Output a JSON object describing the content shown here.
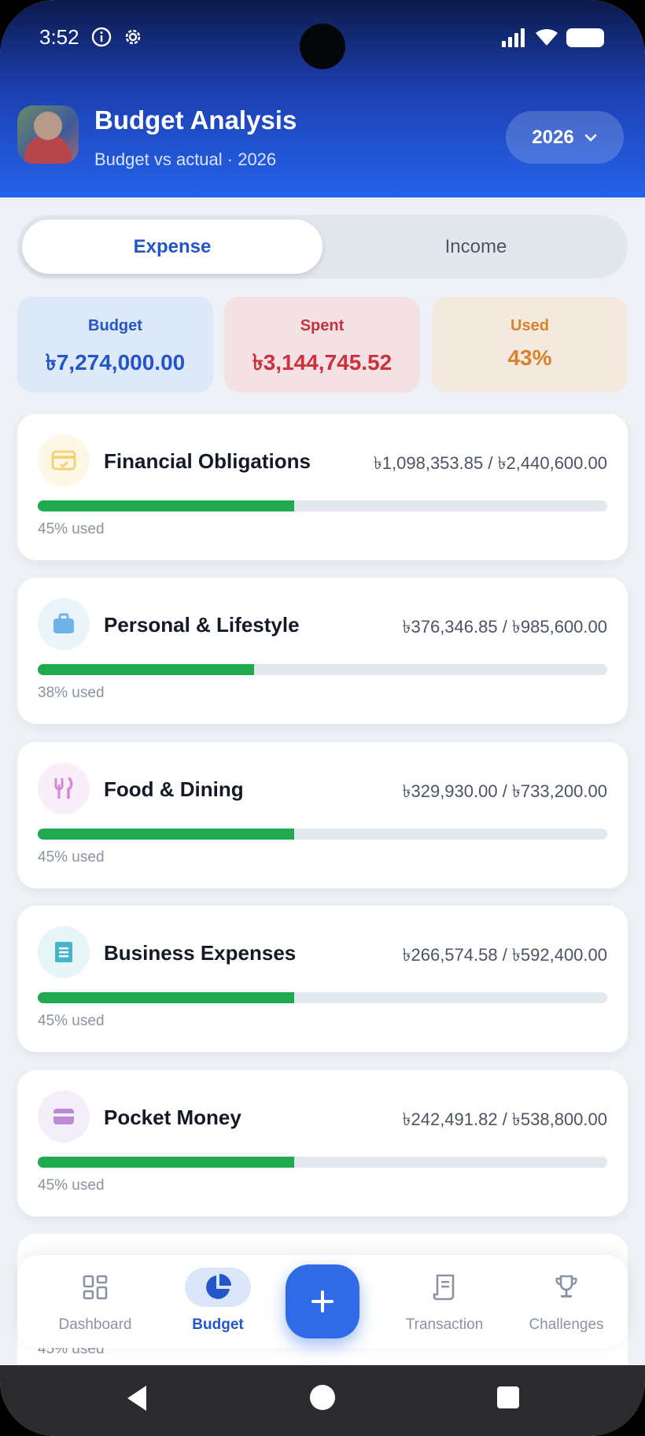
{
  "status_bar": {
    "time": "3:52"
  },
  "header": {
    "title": "Budget Analysis",
    "subtitle": "Budget vs actual · 2026",
    "year_selector": "2026"
  },
  "tabs": [
    {
      "label": "Expense",
      "active": true
    },
    {
      "label": "Income",
      "active": false
    }
  ],
  "summary": {
    "budget": {
      "label": "Budget",
      "value": "৳7,274,000.00"
    },
    "spent": {
      "label": "Spent",
      "value": "৳3,144,745.52"
    },
    "used": {
      "label": "Used",
      "value": "43%"
    }
  },
  "categories": [
    {
      "name": "Financial Obligations",
      "amount": "৳1,098,353.85 / ৳2,440,600.00",
      "used_label": "45% used",
      "progress": 0.45,
      "icon": "bill-icon",
      "icon_color": "#f2d37a",
      "icon_bg": "#fdf8e6"
    },
    {
      "name": "Personal & Lifestyle",
      "amount": "৳376,346.85 / ৳985,600.00",
      "used_label": "38% used",
      "progress": 0.38,
      "icon": "briefcase-icon",
      "icon_color": "#6fb3e6",
      "icon_bg": "#eaf4fb"
    },
    {
      "name": "Food & Dining",
      "amount": "৳329,930.00 / ৳733,200.00",
      "used_label": "45% used",
      "progress": 0.45,
      "icon": "utensils-icon",
      "icon_color": "#d58ad6",
      "icon_bg": "#fbeefb"
    },
    {
      "name": "Business Expenses",
      "amount": "৳266,574.58 / ৳592,400.00",
      "used_label": "45% used",
      "progress": 0.45,
      "icon": "receipt-icon",
      "icon_color": "#45b5c7",
      "icon_bg": "#e6f6f8"
    },
    {
      "name": "Pocket Money",
      "amount": "৳242,491.82 / ৳538,800.00",
      "used_label": "45% used",
      "progress": 0.45,
      "icon": "wallet-icon",
      "icon_color": "#b98ad6",
      "icon_bg": "#f4eefa"
    }
  ],
  "partial_card": {
    "used_label": "45% used"
  },
  "bottom_nav": [
    {
      "label": "Dashboard",
      "icon": "dashboard-icon",
      "active": false
    },
    {
      "label": "Budget",
      "icon": "pie-chart-icon",
      "active": true
    },
    {
      "label": "Transaction",
      "icon": "receipt-icon",
      "active": false
    },
    {
      "label": "Challenges",
      "icon": "trophy-icon",
      "active": false
    }
  ],
  "colors": {
    "accent": "#2356c9",
    "progress": "#1faa4f",
    "spent": "#d0303a",
    "used": "#d9822b"
  }
}
